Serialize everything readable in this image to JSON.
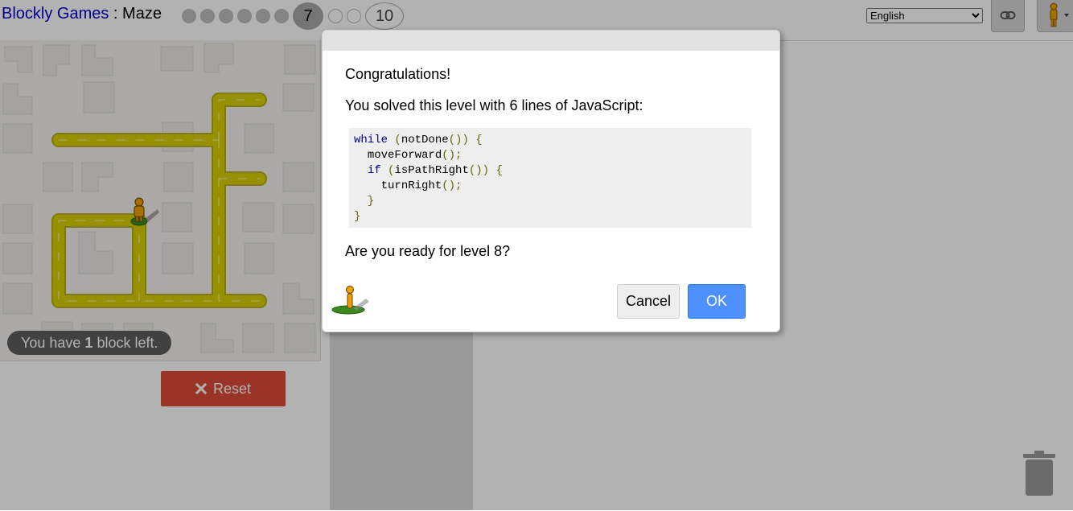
{
  "header": {
    "title_link": "Blockly Games",
    "title_sep": " : ",
    "title_game": "Maze",
    "levels_done": 6,
    "levels_before_last_future": 2,
    "current_level": "7",
    "last_level": "10",
    "language": "English",
    "link_icon": "link-icon",
    "avatar_icon": "pegman-icon"
  },
  "maze": {
    "blocks_left_prefix": "You have ",
    "blocks_left_count": "1",
    "blocks_left_suffix": " block left.",
    "reset_label": "Reset",
    "reset_icon": "close-icon",
    "path_color": "#d8d000",
    "reset_color": "#dd4b39"
  },
  "workspace": {
    "trash_icon": "trash-icon"
  },
  "dialog": {
    "heading": "Congratulations!",
    "solved_text": "You solved this level with 6 lines of JavaScript:",
    "code_lines": [
      "while (notDone()) {",
      "  moveForward();",
      "  if (isPathRight()) {",
      "    turnRight();",
      "  }",
      "}"
    ],
    "next_prompt": "Are you ready for level 8?",
    "cancel_label": "Cancel",
    "ok_label": "OK",
    "ok_color": "#4d90fe"
  }
}
